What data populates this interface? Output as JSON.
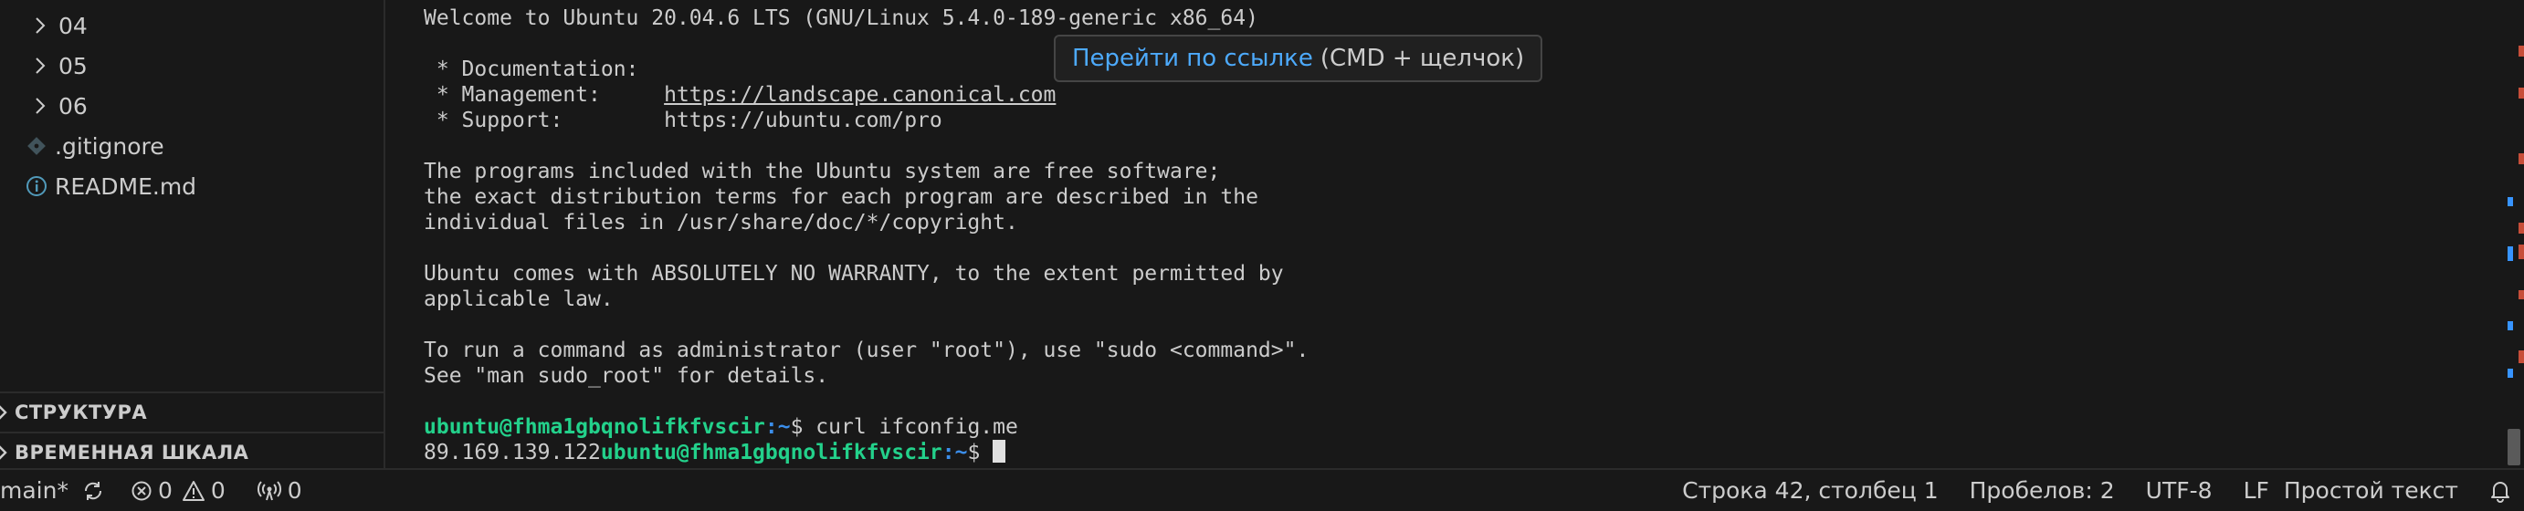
{
  "sidebar": {
    "folders": [
      {
        "label": "04"
      },
      {
        "label": "05"
      },
      {
        "label": "06"
      }
    ],
    "files": [
      {
        "label": ".gitignore",
        "icon": "git-icon"
      },
      {
        "label": "README.md",
        "icon": "info-icon"
      }
    ],
    "sections": [
      {
        "label": "СТРУКТУРА"
      },
      {
        "label": "ВРЕМЕННАЯ ШКАЛА"
      }
    ]
  },
  "terminal": {
    "lines": {
      "welcome": "Welcome to Ubuntu 20.04.6 LTS (GNU/Linux 5.4.0-189-generic x86_64)",
      "documentation": " * Documentation:",
      "management_label": " * Management:     ",
      "management_url": "https://landscape.canonical.com",
      "support": " * Support:        https://ubuntu.com/pro",
      "programs_1": "The programs included with the Ubuntu system are free software;",
      "programs_2": "the exact distribution terms for each program are described in the",
      "programs_3": "individual files in /usr/share/doc/*/copyright.",
      "warranty_1": "Ubuntu comes with ABSOLUTELY NO WARRANTY, to the extent permitted by",
      "warranty_2": "applicable law.",
      "sudo_1": "To run a command as administrator (user \"root\"), use \"sudo <command>\".",
      "sudo_2": "See \"man sudo_root\" for details."
    },
    "prompt": {
      "user_host": "ubuntu@fhma1gbqnolifkfvscir",
      "path": ":~",
      "symbol": "$ ",
      "command": "curl ifconfig.me"
    },
    "output_ip": "89.169.139.122",
    "tooltip": {
      "link_text": "Перейти по ссылке",
      "hint": "(CMD + щелчок)"
    }
  },
  "statusbar": {
    "branch": "main*",
    "errors": "0",
    "warnings": "0",
    "ports": "0",
    "cursor_position": "Строка 42, столбец 1",
    "indentation": "Пробелов: 2",
    "encoding": "UTF-8",
    "eol": "LF",
    "language": "Простой текст"
  },
  "colors": {
    "background": "#181818",
    "prompt_user": "#23d18b",
    "prompt_path": "#3b8eea",
    "link": "#4daafc",
    "marker_red": "#c74e39",
    "marker_blue": "#3794ff"
  }
}
